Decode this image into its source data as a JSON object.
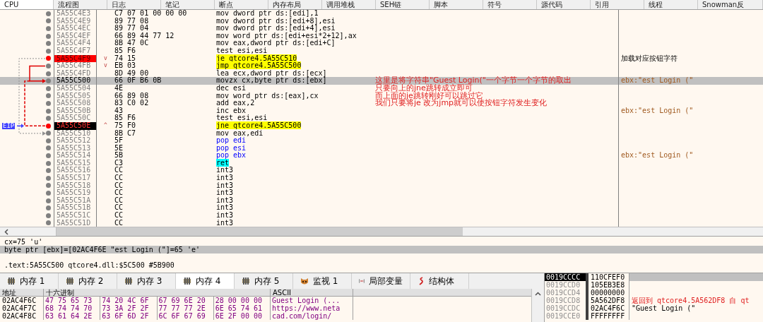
{
  "tabs": [
    {
      "label": "CPU",
      "selected": true
    },
    {
      "label": "流程图",
      "selected": false
    },
    {
      "label": "日志",
      "selected": false
    },
    {
      "label": "笔记",
      "selected": false
    },
    {
      "label": "断点",
      "selected": false
    },
    {
      "label": "内存布局",
      "selected": false
    },
    {
      "label": "调用堆栈",
      "selected": false
    },
    {
      "label": "SEH链",
      "selected": false
    },
    {
      "label": "脚本",
      "selected": false
    },
    {
      "label": "符号",
      "selected": false
    },
    {
      "label": "源代码",
      "selected": false
    },
    {
      "label": "引用",
      "selected": false
    },
    {
      "label": "线程",
      "selected": false
    },
    {
      "label": "Snowman反",
      "selected": false
    }
  ],
  "disassembly": {
    "eip_label": "EIP",
    "rows": [
      {
        "address": "5A55C4E3",
        "branch": "",
        "bytes": "C7 07 01 00 00 00",
        "instruction": "mov dword ptr ds:[edi],1",
        "kind": "normal",
        "selected": false,
        "breakpoint": false,
        "eip": false,
        "comment": ""
      },
      {
        "address": "5A55C4E9",
        "branch": "",
        "bytes": "89 77 08",
        "instruction": "mov dword ptr ds:[edi+8],esi",
        "kind": "normal",
        "selected": false,
        "breakpoint": false,
        "eip": false,
        "comment": ""
      },
      {
        "address": "5A55C4EC",
        "branch": "",
        "bytes": "89 77 04",
        "instruction": "mov dword ptr ds:[edi+4],esi",
        "kind": "normal",
        "selected": false,
        "breakpoint": false,
        "eip": false,
        "comment": ""
      },
      {
        "address": "5A55C4EF",
        "branch": "",
        "bytes": "66 89 44 77 12",
        "instruction": "mov word ptr ds:[edi+esi*2+12],ax",
        "kind": "normal",
        "selected": false,
        "breakpoint": false,
        "eip": false,
        "comment": ""
      },
      {
        "address": "5A55C4F4",
        "branch": "",
        "bytes": "8B 47 0C",
        "instruction": "mov eax,dword ptr ds:[edi+C]",
        "kind": "normal",
        "selected": false,
        "breakpoint": false,
        "eip": false,
        "comment": ""
      },
      {
        "address": "5A55C4F7",
        "branch": "",
        "bytes": "85 F6",
        "instruction": "test esi,esi",
        "kind": "normal",
        "selected": false,
        "breakpoint": false,
        "eip": false,
        "comment": ""
      },
      {
        "address": "5A55C4F9",
        "branch": "v",
        "bytes": "74 15",
        "instruction": "je qtcore4.5A55C510",
        "kind": "jump",
        "selected": false,
        "breakpoint": true,
        "eip": false,
        "comment": "加载对应按钮字符"
      },
      {
        "address": "5A55C4FB",
        "branch": "v",
        "bytes": "EB 03",
        "instruction": "jmp qtcore4.5A55C500",
        "kind": "jump",
        "selected": false,
        "breakpoint": false,
        "eip": false,
        "comment": ""
      },
      {
        "address": "5A55C4FD",
        "branch": "",
        "bytes": "8D 49 00",
        "instruction": "lea ecx,dword ptr ds:[ecx]",
        "kind": "normal",
        "selected": false,
        "breakpoint": false,
        "eip": false,
        "comment": ""
      },
      {
        "address": "5A55C500",
        "branch": "",
        "bytes": "66 0F B6 0B",
        "instruction": "movzx cx,byte ptr ds:[ebx]",
        "kind": "normal",
        "selected": true,
        "breakpoint": false,
        "eip": false,
        "comment": "ebx:\"est Login (\""
      },
      {
        "address": "5A55C504",
        "branch": "",
        "bytes": "4E",
        "instruction": "dec esi",
        "kind": "normal",
        "selected": false,
        "breakpoint": false,
        "eip": false,
        "comment": ""
      },
      {
        "address": "5A55C505",
        "branch": "",
        "bytes": "66 89 08",
        "instruction": "mov word ptr ds:[eax],cx",
        "kind": "normal",
        "selected": false,
        "breakpoint": false,
        "eip": false,
        "comment": ""
      },
      {
        "address": "5A55C508",
        "branch": "",
        "bytes": "83 C0 02",
        "instruction": "add eax,2",
        "kind": "normal",
        "selected": false,
        "breakpoint": false,
        "eip": false,
        "comment": ""
      },
      {
        "address": "5A55C50B",
        "branch": "",
        "bytes": "43",
        "instruction": "inc ebx",
        "kind": "normal",
        "selected": false,
        "breakpoint": false,
        "eip": false,
        "comment": "ebx:\"est Login (\""
      },
      {
        "address": "5A55C50C",
        "branch": "",
        "bytes": "85 F6",
        "instruction": "test esi,esi",
        "kind": "normal",
        "selected": false,
        "breakpoint": false,
        "eip": false,
        "comment": ""
      },
      {
        "address": "5A55C50E",
        "branch": "^",
        "bytes": "75 F0",
        "instruction": "jne qtcore4.5A55C500",
        "kind": "jump",
        "selected": false,
        "breakpoint": true,
        "eip": true,
        "comment": ""
      },
      {
        "address": "5A55C510",
        "branch": "",
        "bytes": "8B C7",
        "instruction": "mov eax,edi",
        "kind": "normal",
        "selected": false,
        "breakpoint": false,
        "eip": false,
        "comment": ""
      },
      {
        "address": "5A55C512",
        "branch": "",
        "bytes": "5F",
        "instruction": "pop edi",
        "kind": "stack",
        "selected": false,
        "breakpoint": false,
        "eip": false,
        "comment": ""
      },
      {
        "address": "5A55C513",
        "branch": "",
        "bytes": "5E",
        "instruction": "pop esi",
        "kind": "stack",
        "selected": false,
        "breakpoint": false,
        "eip": false,
        "comment": ""
      },
      {
        "address": "5A55C514",
        "branch": "",
        "bytes": "5B",
        "instruction": "pop ebx",
        "kind": "stack",
        "selected": false,
        "breakpoint": false,
        "eip": false,
        "comment": "ebx:\"est Login (\""
      },
      {
        "address": "5A55C515",
        "branch": "",
        "bytes": "C3",
        "instruction": "ret",
        "kind": "return",
        "selected": false,
        "breakpoint": false,
        "eip": false,
        "comment": ""
      },
      {
        "address": "5A55C516",
        "branch": "",
        "bytes": "CC",
        "instruction": "int3",
        "kind": "normal",
        "selected": false,
        "breakpoint": false,
        "eip": false,
        "comment": ""
      },
      {
        "address": "5A55C517",
        "branch": "",
        "bytes": "CC",
        "instruction": "int3",
        "kind": "normal",
        "selected": false,
        "breakpoint": false,
        "eip": false,
        "comment": ""
      },
      {
        "address": "5A55C518",
        "branch": "",
        "bytes": "CC",
        "instruction": "int3",
        "kind": "normal",
        "selected": false,
        "breakpoint": false,
        "eip": false,
        "comment": ""
      },
      {
        "address": "5A55C519",
        "branch": "",
        "bytes": "CC",
        "instruction": "int3",
        "kind": "normal",
        "selected": false,
        "breakpoint": false,
        "eip": false,
        "comment": ""
      },
      {
        "address": "5A55C51A",
        "branch": "",
        "bytes": "CC",
        "instruction": "int3",
        "kind": "normal",
        "selected": false,
        "breakpoint": false,
        "eip": false,
        "comment": ""
      },
      {
        "address": "5A55C51B",
        "branch": "",
        "bytes": "CC",
        "instruction": "int3",
        "kind": "normal",
        "selected": false,
        "breakpoint": false,
        "eip": false,
        "comment": ""
      },
      {
        "address": "5A55C51C",
        "branch": "",
        "bytes": "CC",
        "instruction": "int3",
        "kind": "normal",
        "selected": false,
        "breakpoint": false,
        "eip": false,
        "comment": ""
      },
      {
        "address": "5A55C51D",
        "branch": "",
        "bytes": "CC",
        "instruction": "int3",
        "kind": "normal",
        "selected": false,
        "breakpoint": false,
        "eip": false,
        "comment": ""
      }
    ]
  },
  "annotation": {
    "lines": [
      "这里是将字符串\"Guest Login(\"一个字节一个字节的取出",
      "只要向上的jne跳转成立即可",
      "而上面的je跳转刚好可以跳过它",
      "我们只要将je 改为jmp就可以使按钮字符发生变化"
    ]
  },
  "info": {
    "lines": [
      {
        "text": "cx=75 'u'",
        "selected": false
      },
      {
        "text": "byte ptr [ebx]=[02AC4F6E \"est Login (\"]=65 'e'",
        "selected": true
      }
    ],
    "location": ".text:5A55C500 qtcore4.dll:$5C500 #5B900"
  },
  "dump_tabs": [
    {
      "label": "内存 1",
      "kind": "memory",
      "selected": false
    },
    {
      "label": "内存 2",
      "kind": "memory",
      "selected": false
    },
    {
      "label": "内存 3",
      "kind": "memory",
      "selected": false
    },
    {
      "label": "内存 4",
      "kind": "memory",
      "selected": true
    },
    {
      "label": "内存 5",
      "kind": "memory",
      "selected": false
    },
    {
      "label": "监视 1",
      "kind": "watch",
      "selected": false
    },
    {
      "label": "局部变量",
      "kind": "locals",
      "selected": false
    },
    {
      "label": "结构体",
      "kind": "struct",
      "selected": false
    }
  ],
  "dump": {
    "columns": [
      "地址",
      "十六进制",
      "ASCII"
    ],
    "rows": [
      {
        "address": "02AC4F6C",
        "groups": [
          "47 75 65 73",
          "74 20 4C 6F",
          "67 69 6E 20",
          "28 00 00 00"
        ],
        "ascii": "Guest Login (..."
      },
      {
        "address": "02AC4F7C",
        "groups": [
          "68 74 74 70",
          "73 3A 2F 2F",
          "77 77 77 2E",
          "6E 65 74 61"
        ],
        "ascii": "https://www.neta"
      },
      {
        "address": "02AC4F8C",
        "groups": [
          "63 61 64 2E",
          "63 6F 6D 2F",
          "6C 6F 67 69",
          "6E 2F 00 00"
        ],
        "ascii": "cad.com/login/"
      }
    ]
  },
  "stack": {
    "rows": [
      {
        "address": "0019CCCC",
        "value": "110CFEF0",
        "selected": true
      },
      {
        "address": "0019CCD0",
        "value": "105EB3E8",
        "selected": false
      },
      {
        "address": "0019CCD4",
        "value": "00000000",
        "selected": false
      },
      {
        "address": "0019CCD8",
        "value": "5A562DF8",
        "comment": "返回到 qtcore4.5A562DF8 自 qt",
        "kind": "return",
        "selected": false
      },
      {
        "address": "0019CCDC",
        "value": "02AC4F6C",
        "comment": "\"Guest Login (\"",
        "kind": "string",
        "selected": false
      },
      {
        "address": "0019CCE0",
        "value": "FFFFFFFF",
        "selected": false
      }
    ]
  }
}
